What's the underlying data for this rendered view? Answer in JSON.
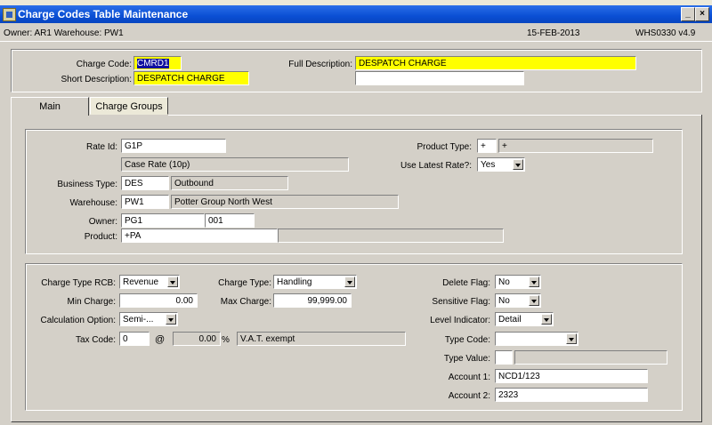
{
  "window": {
    "title": "Charge Codes Table Maintenance",
    "minimize_glyph": "_",
    "close_glyph": "×"
  },
  "infobar": {
    "owner_warehouse": "Owner: AR1  Warehouse: PW1",
    "date": "15-FEB-2013",
    "version": "WHS0330  v4.9"
  },
  "header": {
    "charge_code_label": "Charge Code:",
    "charge_code": "CMRD1",
    "short_description_label": "Short Description:",
    "short_description": "DESPATCH CHARGE",
    "full_description_label": "Full Description:",
    "full_description": "DESPATCH CHARGE",
    "full_description_2": ""
  },
  "tabs": [
    {
      "label": "Main",
      "active": true
    },
    {
      "label": "Charge Groups",
      "active": false
    }
  ],
  "rate": {
    "rate_id_label": "Rate Id:",
    "rate_id": "G1P",
    "rate_desc": "Case Rate (10p)",
    "business_type_label": "Business Type:",
    "business_type": "DES",
    "business_type_desc": "Outbound",
    "warehouse_label": "Warehouse:",
    "warehouse": "PW1",
    "warehouse_desc": "Potter Group North West",
    "owner_label": "Owner:",
    "owner": "PG1",
    "owner_code": "001",
    "product_label": "Product:",
    "product": "+PA",
    "product_desc": "",
    "product_type_label": "Product Type:",
    "product_type": "+",
    "product_type_desc": "+",
    "use_latest_rate_label": "Use Latest Rate?:",
    "use_latest_rate": "Yes"
  },
  "charges": {
    "charge_type_rcb_label": "Charge Type RCB:",
    "charge_type_rcb": "Revenue",
    "charge_type_label": "Charge Type:",
    "charge_type": "Handling",
    "min_charge_label": "Min Charge:",
    "min_charge": "0.00",
    "max_charge_label": "Max Charge:",
    "max_charge": "99,999.00",
    "calculation_option_label": "Calculation Option:",
    "calculation_option": "Semi-...",
    "tax_code_label": "Tax Code:",
    "tax_code": "0",
    "at_sign": "@",
    "tax_rate": "0.00",
    "percent_sign": "%",
    "tax_desc": "V.A.T. exempt",
    "delete_flag_label": "Delete Flag:",
    "delete_flag": "No",
    "sensitive_flag_label": "Sensitive Flag:",
    "sensitive_flag": "No",
    "level_indicator_label": "Level Indicator:",
    "level_indicator": "Detail",
    "type_code_label": "Type Code:",
    "type_code": "",
    "type_value_label": "Type Value:",
    "type_value": "",
    "type_value_desc": "",
    "account1_label": "Account 1:",
    "account1": "NCD1/123",
    "account2_label": "Account 2:",
    "account2": "2323"
  },
  "colors": {
    "titlebar": "#0a4fd4",
    "highlight": "#ffff00",
    "selection": "#1010a0",
    "window_bg": "#d4d0c8"
  }
}
